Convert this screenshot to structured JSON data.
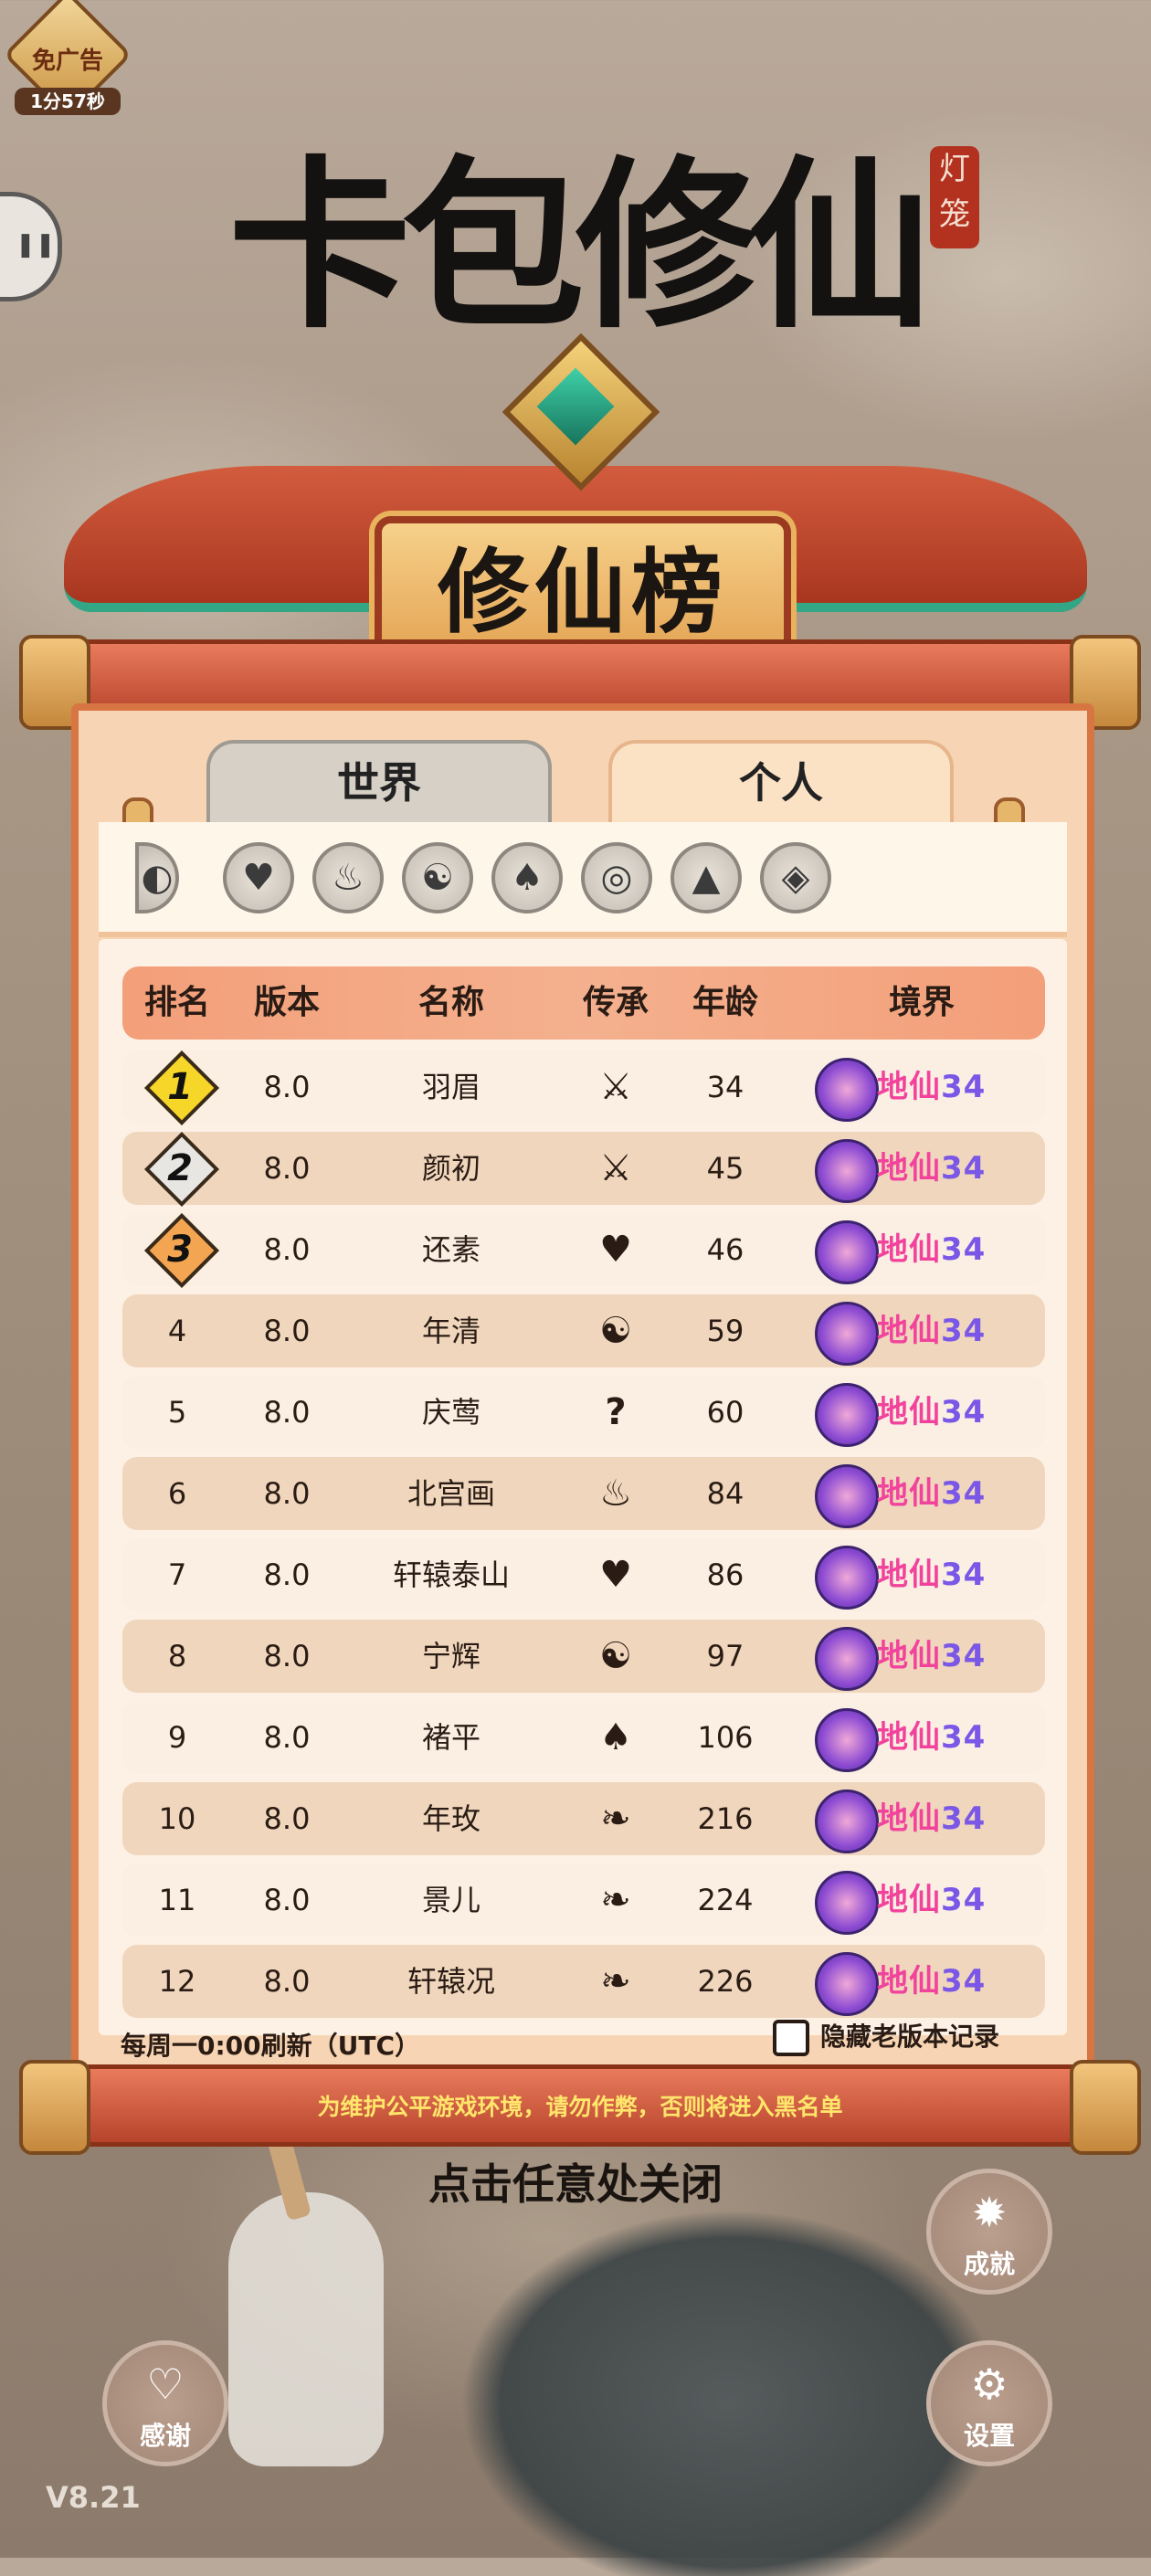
{
  "ad_badge": {
    "label": "免广告",
    "timer": "1分57秒"
  },
  "title": {
    "main": "卡包修仙",
    "stamp": "灯笼"
  },
  "board_title": "修仙榜",
  "tabs": [
    {
      "label": "世界"
    },
    {
      "label": "个人"
    }
  ],
  "columns": [
    "排名",
    "版本",
    "名称",
    "传承",
    "年龄",
    "境界"
  ],
  "filter_icons": [
    "partial-icon",
    "heart-icon",
    "fire-icon",
    "yin-yang-icon",
    "flame-icon",
    "ring-icon",
    "mountain-icon",
    "shield-icon"
  ],
  "rows": [
    {
      "rank": "1",
      "version": "8.0",
      "name": "羽眉",
      "lineage_icon": "sword-icon",
      "age": "34",
      "realm": "地仙",
      "realm_level": "34"
    },
    {
      "rank": "2",
      "version": "8.0",
      "name": "颜初",
      "lineage_icon": "sword-icon",
      "age": "45",
      "realm": "地仙",
      "realm_level": "34"
    },
    {
      "rank": "3",
      "version": "8.0",
      "name": "还素",
      "lineage_icon": "heart-icon",
      "age": "46",
      "realm": "地仙",
      "realm_level": "34"
    },
    {
      "rank": "4",
      "version": "8.0",
      "name": "年清",
      "lineage_icon": "yin-yang-icon",
      "age": "59",
      "realm": "地仙",
      "realm_level": "34"
    },
    {
      "rank": "5",
      "version": "8.0",
      "name": "庆莺",
      "lineage_icon": "question-icon",
      "age": "60",
      "realm": "地仙",
      "realm_level": "34"
    },
    {
      "rank": "6",
      "version": "8.0",
      "name": "北宫画",
      "lineage_icon": "fire-icon",
      "age": "84",
      "realm": "地仙",
      "realm_level": "34"
    },
    {
      "rank": "7",
      "version": "8.0",
      "name": "轩辕泰山",
      "lineage_icon": "heart-icon",
      "age": "86",
      "realm": "地仙",
      "realm_level": "34"
    },
    {
      "rank": "8",
      "version": "8.0",
      "name": "宁辉",
      "lineage_icon": "yin-yang-icon",
      "age": "97",
      "realm": "地仙",
      "realm_level": "34"
    },
    {
      "rank": "9",
      "version": "8.0",
      "name": "褚平",
      "lineage_icon": "flame-icon",
      "age": "106",
      "realm": "地仙",
      "realm_level": "34"
    },
    {
      "rank": "10",
      "version": "8.0",
      "name": "年玫",
      "lineage_icon": "book-icon",
      "age": "216",
      "realm": "地仙",
      "realm_level": "34"
    },
    {
      "rank": "11",
      "version": "8.0",
      "name": "景儿",
      "lineage_icon": "book-icon",
      "age": "224",
      "realm": "地仙",
      "realm_level": "34"
    },
    {
      "rank": "12",
      "version": "8.0",
      "name": "轩辕况",
      "lineage_icon": "book-icon",
      "age": "226",
      "realm": "地仙",
      "realm_level": "34"
    }
  ],
  "footer": {
    "refresh_note": "每周一0:00刷新（UTC）",
    "hide_old_label": "隐藏老版本记录"
  },
  "warning": "为维护公平游戏环境，请勿作弊，否则将进入黑名单",
  "close_hint": "点击任意处关闭",
  "buttons": {
    "achievement": "成就",
    "thanks": "感谢",
    "settings": "设置"
  },
  "version": "V8.21",
  "colors": {
    "realm_text": "#f2439c",
    "realm_level": "#7a57e6",
    "panel_border": "#d77543",
    "header_row": "#f39f79"
  }
}
